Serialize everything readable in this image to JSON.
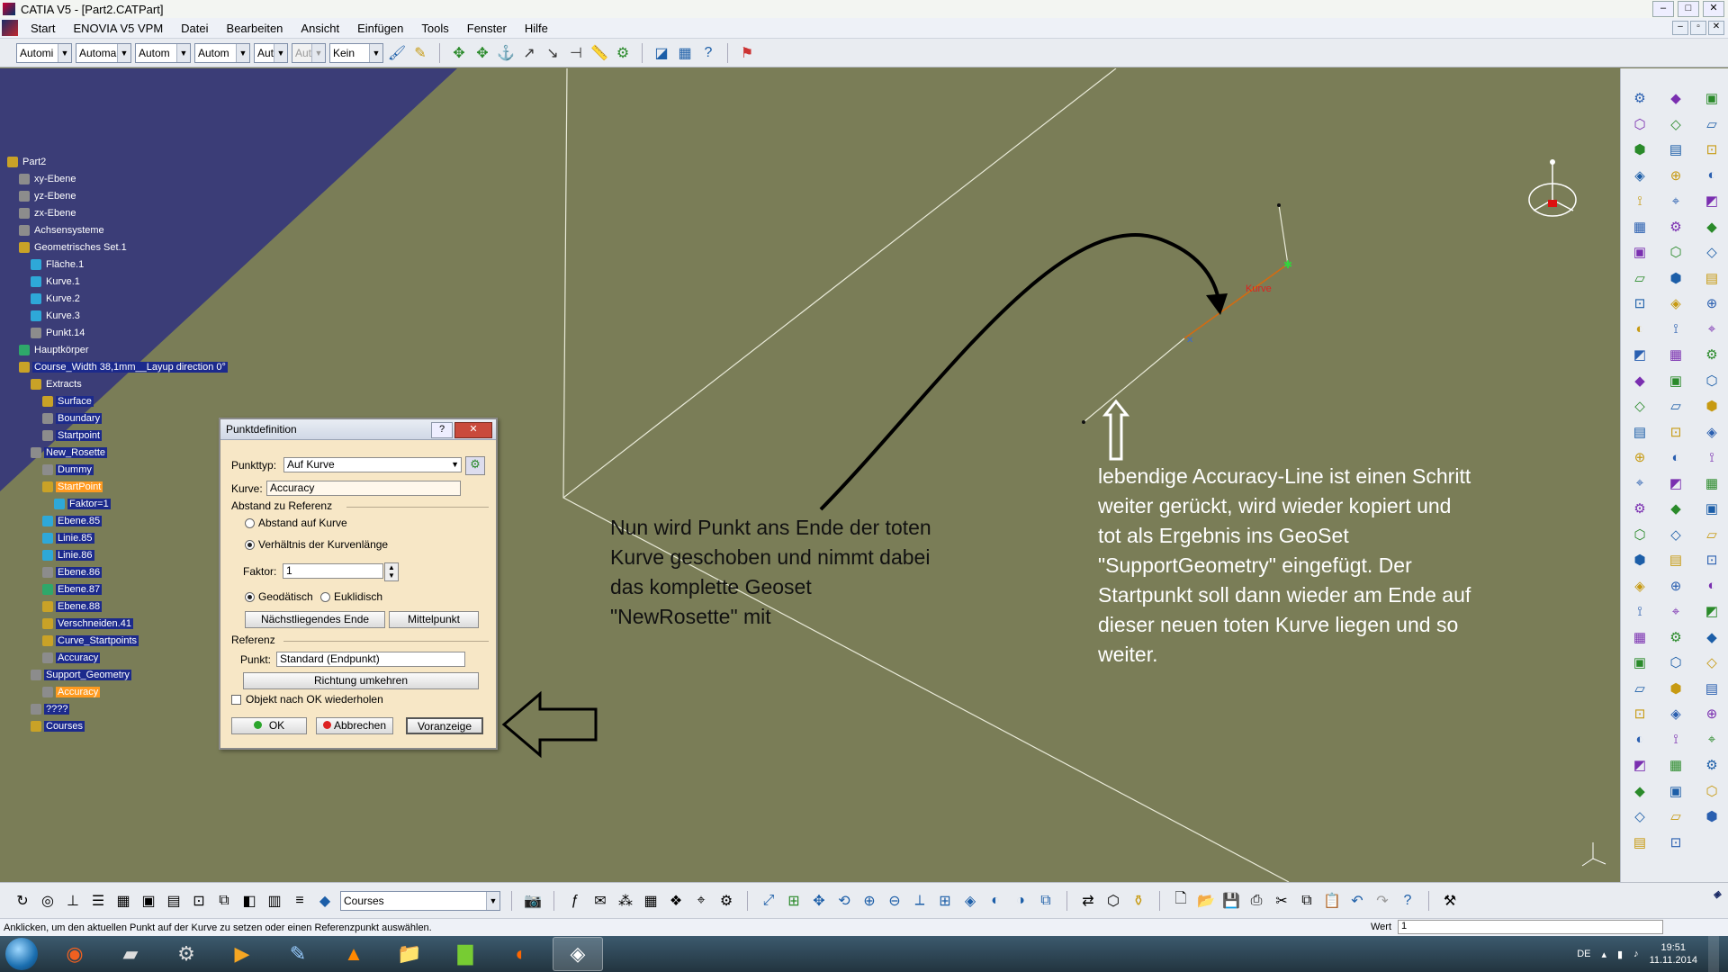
{
  "window": {
    "title": "CATIA V5 - [Part2.CATPart]"
  },
  "menu": [
    "Start",
    "ENOVIA V5 VPM",
    "Datei",
    "Bearbeiten",
    "Ansicht",
    "Einfügen",
    "Tools",
    "Fenster",
    "Hilfe"
  ],
  "top_toolbar": {
    "combos": [
      "Automi",
      "Automa",
      "Autom",
      "Autom",
      "Aut",
      "Aut",
      "Kein"
    ]
  },
  "tree": {
    "items": [
      {
        "label": "Part2",
        "level": 0,
        "style": "plain"
      },
      {
        "label": "xy-Ebene",
        "level": 1,
        "style": "plain"
      },
      {
        "label": "yz-Ebene",
        "level": 1,
        "style": "plain"
      },
      {
        "label": "zx-Ebene",
        "level": 1,
        "style": "plain"
      },
      {
        "label": "Achsensysteme",
        "level": 1,
        "style": "plain"
      },
      {
        "label": "Geometrisches Set.1",
        "level": 1,
        "style": "plain"
      },
      {
        "label": "Fläche.1",
        "level": 2,
        "style": "plain"
      },
      {
        "label": "Kurve.1",
        "level": 2,
        "style": "plain"
      },
      {
        "label": "Kurve.2",
        "level": 2,
        "style": "plain"
      },
      {
        "label": "Kurve.3",
        "level": 2,
        "style": "plain"
      },
      {
        "label": "Punkt.14",
        "level": 2,
        "style": "plain"
      },
      {
        "label": "Hauptkörper",
        "level": 1,
        "style": "plain"
      },
      {
        "label": "Course_Width 38,1mm__Layup direction 0°",
        "level": 1,
        "style": "hl"
      },
      {
        "label": "Extracts",
        "level": 2,
        "style": "plain"
      },
      {
        "label": "Surface",
        "level": 3,
        "style": "hl"
      },
      {
        "label": "Boundary",
        "level": 3,
        "style": "hl"
      },
      {
        "label": "Startpoint",
        "level": 3,
        "style": "hl"
      },
      {
        "label": "New_Rosette",
        "level": 2,
        "style": "hl"
      },
      {
        "label": "Dummy",
        "level": 3,
        "style": "hl"
      },
      {
        "label": "StartPoint",
        "level": 3,
        "style": "sel"
      },
      {
        "label": "Faktor=1",
        "level": 4,
        "style": "hl"
      },
      {
        "label": "Ebene.85",
        "level": 3,
        "style": "hl"
      },
      {
        "label": "Linie.85",
        "level": 3,
        "style": "hl"
      },
      {
        "label": "Linie.86",
        "level": 3,
        "style": "hl"
      },
      {
        "label": "Ebene.86",
        "level": 3,
        "style": "hl"
      },
      {
        "label": "Ebene.87",
        "level": 3,
        "style": "hl"
      },
      {
        "label": "Ebene.88",
        "level": 3,
        "style": "hl"
      },
      {
        "label": "Verschneiden.41",
        "level": 3,
        "style": "hl"
      },
      {
        "label": "Curve_Startpoints",
        "level": 3,
        "style": "hl"
      },
      {
        "label": "Accuracy",
        "level": 3,
        "style": "hl"
      },
      {
        "label": "Support_Geometry",
        "level": 2,
        "style": "hl"
      },
      {
        "label": "Accuracy",
        "level": 3,
        "style": "sel"
      },
      {
        "label": "????",
        "level": 2,
        "style": "hl"
      },
      {
        "label": "Courses",
        "level": 2,
        "style": "hl"
      }
    ]
  },
  "dialog": {
    "title": "Punktdefinition",
    "help": "?",
    "close": "✕",
    "punkttyp_label": "Punkttyp:",
    "punkttyp_value": "Auf Kurve",
    "kurve_label": "Kurve:",
    "kurve_value": "Accuracy",
    "abstand_header": "Abstand zu Referenz",
    "radio_abstand": "Abstand auf Kurve",
    "radio_verhaeltnis": "Verhältnis der Kurvenlänge",
    "faktor_label": "Faktor:",
    "faktor_value": "1",
    "radio_geodaetisch": "Geodätisch",
    "radio_euklidisch": "Euklidisch",
    "btn_naechstes": "Nächstliegendes Ende",
    "btn_mittelpunkt": "Mittelpunkt",
    "referenz_header": "Referenz",
    "punkt_label": "Punkt:",
    "punkt_value": "Standard (Endpunkt)",
    "btn_richtung": "Richtung umkehren",
    "check_wiederholen": "Objekt nach OK wiederholen",
    "btn_ok": "OK",
    "btn_abbrechen": "Abbrechen",
    "btn_voranzeige": "Voranzeige"
  },
  "viewport": {
    "curve_label": "Kurve"
  },
  "annotations": {
    "middle": [
      "Nun wird Punkt ans Ende der toten",
      "Kurve geschoben und nimmt dabei",
      "das komplette Geoset",
      "\"NewRosette\" mit"
    ],
    "right": [
      "lebendige Accuracy-Line ist einen Schritt",
      "weiter gerückt, wird wieder kopiert und",
      "tot als Ergebnis ins GeoSet",
      "\"SupportGeometry\" eingefügt. Der",
      "Startpunkt soll dann wieder am Ende auf",
      "dieser neuen toten Kurve liegen und so",
      "weiter."
    ]
  },
  "bottom_toolbar": {
    "combo_value": "Courses"
  },
  "statusbar": {
    "message": "Anklicken, um den aktuellen Punkt auf der Kurve zu setzen oder einen Referenzpunkt auswählen.",
    "wert_label": "Wert",
    "wert_value": "1"
  },
  "taskbar": {
    "lang": "DE",
    "time": "19:51",
    "date": "11.11.2014"
  },
  "colors": {
    "viewport_bg": "#7a7d57",
    "tree_highlight": "#1c2a8c",
    "tree_selected": "#ff9a1f",
    "dialog_bg": "#f7e7c6"
  }
}
